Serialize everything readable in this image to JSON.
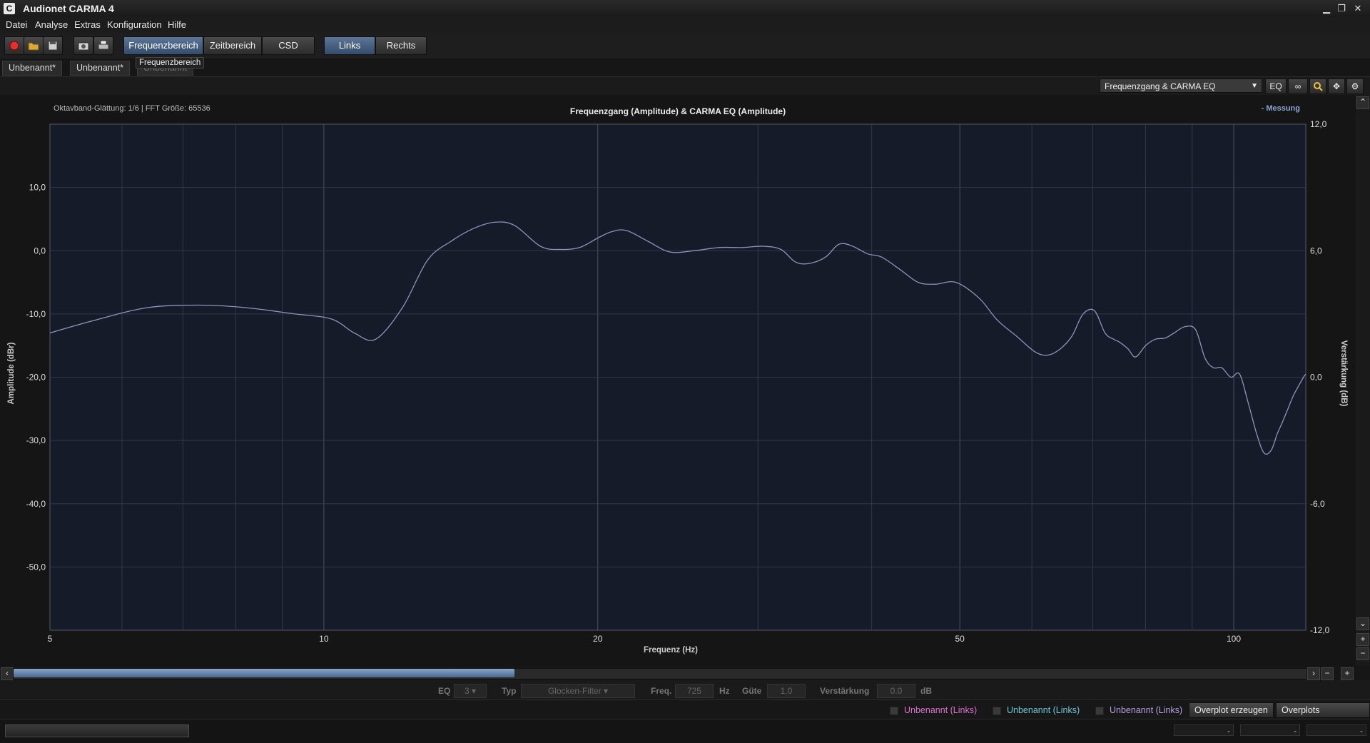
{
  "window": {
    "title": "Audionet CARMA 4",
    "icon_letter": "C",
    "minimize": "▁",
    "restore": "❐",
    "close": "✕"
  },
  "menu": [
    "Datei",
    "Analyse",
    "Extras",
    "Konfiguration",
    "Hilfe"
  ],
  "toolbar": {
    "record_icon": "record-icon",
    "open_icon": "folder-open-icon",
    "save_icon": "save-icon",
    "screenshot_icon": "camera-icon",
    "print_icon": "print-icon",
    "views": [
      "Frequenzbereich",
      "Zeitbereich",
      "CSD"
    ],
    "channels": [
      "Links",
      "Rechts"
    ],
    "active_view": "Frequenzbereich",
    "active_channel": "Links"
  },
  "tabs": [
    "Unbenannt*",
    "Unbenannt*",
    "Unbenannt"
  ],
  "tooltip": "Frequenzbereich",
  "view_header": {
    "selected_view": "Frequenzgang & CARMA EQ",
    "eq_button": "EQ",
    "link_icon": "link-icon",
    "zoom_icon": "zoom-icon",
    "pan_icon": "pan-icon",
    "settings_icon": "gear-icon"
  },
  "colors": {
    "plot_bg": "#161b2a",
    "grid": "#30394a",
    "curve": "#8b95b8",
    "accent": "#4a6a92",
    "legend": "#8ca4d6",
    "overlay1": "#e26fd0",
    "overlay2": "#6ec6d8",
    "overlay3": "#b79ee0"
  },
  "chart_data": {
    "type": "line",
    "title": "Frequenzgang (Amplitude) & CARMA EQ (Amplitude)",
    "annotation": "Oktavband-Glättung: 1/6 | FFT Größe: 65536",
    "legend": "- Messung",
    "xlabel": "Frequenz (Hz)",
    "ylabel": "Amplitude (dBr)",
    "y2label": "Verstärkung (dB)",
    "xscale": "log",
    "xlim": [
      5,
      120
    ],
    "ylim": [
      -60,
      20
    ],
    "y2lim": [
      -12,
      12
    ],
    "x_ticks": [
      5,
      10,
      20,
      50,
      100
    ],
    "x_tick_labels": [
      "5",
      "10",
      "20",
      "50",
      "100"
    ],
    "y_ticks": [
      10,
      0,
      -10,
      -20,
      -30,
      -40,
      -50
    ],
    "y_tick_labels": [
      "10,0",
      "0,0",
      "-10,0",
      "-20,0",
      "-30,0",
      "-40,0",
      "-50,0"
    ],
    "y2_ticks": [
      12,
      6,
      0,
      -6,
      -12
    ],
    "y2_tick_labels": [
      "12,0",
      "6,0",
      "0,0",
      "-6,0",
      "-12,0"
    ],
    "legend_position": "top-right",
    "grid": true,
    "series": [
      {
        "name": "Messung",
        "x": [
          5,
          5.6,
          6.4,
          7.3,
          8.2,
          9.3,
          10.2,
          10.8,
          11.4,
          12.2,
          13.0,
          13.8,
          14.6,
          15.4,
          16.2,
          17.3,
          18.2,
          19.1,
          20.0,
          20.7,
          21.5,
          22.7,
          24.0,
          25.5,
          27.2,
          28.8,
          30.4,
          31.8,
          33.0,
          34.2,
          35.6,
          36.8,
          38.0,
          39.6,
          41.0,
          43.0,
          45.0,
          47.0,
          49.5,
          52.5,
          55.0,
          57.7,
          60.5,
          62.5,
          64.5,
          66.4,
          68.3,
          70.3,
          72.2,
          73.8,
          75.0,
          76.5,
          78.0,
          80.0,
          82.0,
          84.1,
          86.0,
          88.4,
          90.8,
          93.0,
          95.0,
          97.0,
          99.3,
          101.5,
          103.7,
          106.0,
          108.0,
          110.0,
          111.6,
          113.2,
          114.7,
          116.2,
          117.7,
          119.3,
          120.0
        ],
        "y": [
          -13.0,
          -11.0,
          -9.0,
          -8.6,
          -9.0,
          -10.0,
          -10.8,
          -13.0,
          -14.0,
          -9.0,
          -1.5,
          1.5,
          3.5,
          4.5,
          4.0,
          0.7,
          0.2,
          0.5,
          2.0,
          3.0,
          3.2,
          1.5,
          -0.2,
          0.0,
          0.5,
          0.5,
          0.7,
          0.2,
          -1.8,
          -2.0,
          -1.0,
          1.0,
          0.8,
          -0.5,
          -1.0,
          -3.0,
          -5.0,
          -5.3,
          -5.0,
          -7.5,
          -11.0,
          -13.5,
          -16.0,
          -16.5,
          -15.5,
          -13.5,
          -10.0,
          -9.5,
          -13.0,
          -14.0,
          -14.5,
          -15.5,
          -16.8,
          -15.0,
          -14.0,
          -13.8,
          -13.0,
          -12.0,
          -12.5,
          -17.0,
          -18.5,
          -18.5,
          -20.0,
          -19.5,
          -24.0,
          -29.0,
          -32.0,
          -31.5,
          -29.0,
          -27.0,
          -25.0,
          -23.0,
          -21.5,
          -20.0,
          -19.5
        ]
      }
    ]
  },
  "eq": {
    "eq_label": "EQ",
    "eq_value": "3",
    "typ_label": "Typ",
    "typ_value": "Glocken-Filter",
    "freq_label": "Freq.",
    "freq_value": "725",
    "freq_unit": "Hz",
    "q_label": "Güte",
    "q_value": "1.0",
    "gain_label": "Verstärkung",
    "gain_value": "0.0",
    "gain_unit": "dB"
  },
  "overplots": {
    "items": [
      "Unbenannt (Links)",
      "Unbenannt (Links)",
      "Unbenannt (Links)"
    ],
    "create_button": "Overplot erzeugen",
    "edit_button": "Overplots bearbeiten"
  },
  "status": {
    "field1": "-",
    "field2": "-",
    "field3": "-"
  },
  "scroll": {
    "up": "⌃",
    "down": "⌄",
    "left": "‹",
    "right": "›",
    "plus": "+",
    "minus": "−"
  }
}
